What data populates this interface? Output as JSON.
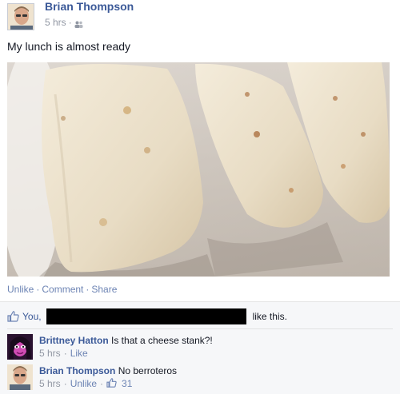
{
  "post": {
    "author": "Brian Thompson",
    "time": "5 hrs",
    "separator": "·",
    "text": "My lunch is almost ready"
  },
  "actions": {
    "unlike": "Unlike",
    "comment": "Comment",
    "share": "Share",
    "separator": "·"
  },
  "likes": {
    "you": "You,",
    "suffix": "like this."
  },
  "comments": [
    {
      "author": "Brittney Hatton",
      "text": "Is that a cheese stank?!",
      "time": "5 hrs",
      "action": "Like",
      "separator": "·"
    },
    {
      "author": "Brian Thompson",
      "text": "No berroteros",
      "time": "5 hrs",
      "action": "Unlike",
      "like_count": "31",
      "separator": "·"
    }
  ],
  "colors": {
    "link": "#3b5998",
    "action_link": "#6d84b4",
    "meta": "#9197a3",
    "ufi_bg": "#f6f7f9",
    "redaction": "#000000"
  },
  "icons": {
    "audience": "friends-icon",
    "like": "thumbs-up-icon"
  }
}
